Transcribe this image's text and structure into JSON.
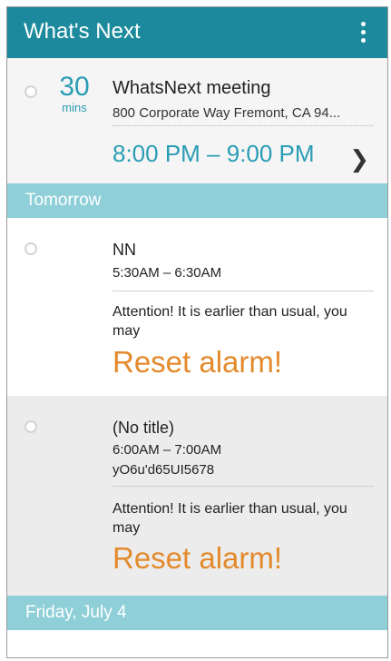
{
  "app": {
    "title": "What's Next"
  },
  "current": {
    "countdown_value": "30",
    "countdown_unit": "mins",
    "title": "WhatsNext meeting",
    "location": "800 Corporate Way Fremont, CA 94...",
    "time": "8:00 PM – 9:00 PM"
  },
  "sections": [
    {
      "label": "Tomorrow",
      "events": [
        {
          "title": "NN",
          "time": "5:30AM – 6:30AM",
          "attention": "Attention! It is earlier than usual, you may",
          "action": "Reset alarm!"
        },
        {
          "title": "(No title)",
          "time": "6:00AM – 7:00AM",
          "subtitle": "yO6u'd65UI5678",
          "attention": "Attention! It is earlier than usual, you may",
          "action": "Reset alarm!"
        }
      ]
    },
    {
      "label": "Friday, July 4"
    }
  ],
  "colors": {
    "accent": "#1c8a9c",
    "section_header": "#8ecfd8",
    "time": "#2a9db5",
    "alert": "#e38a2c"
  },
  "icons": {
    "overflow": "more-vert-icon",
    "chevron": "chevron-right-icon"
  }
}
